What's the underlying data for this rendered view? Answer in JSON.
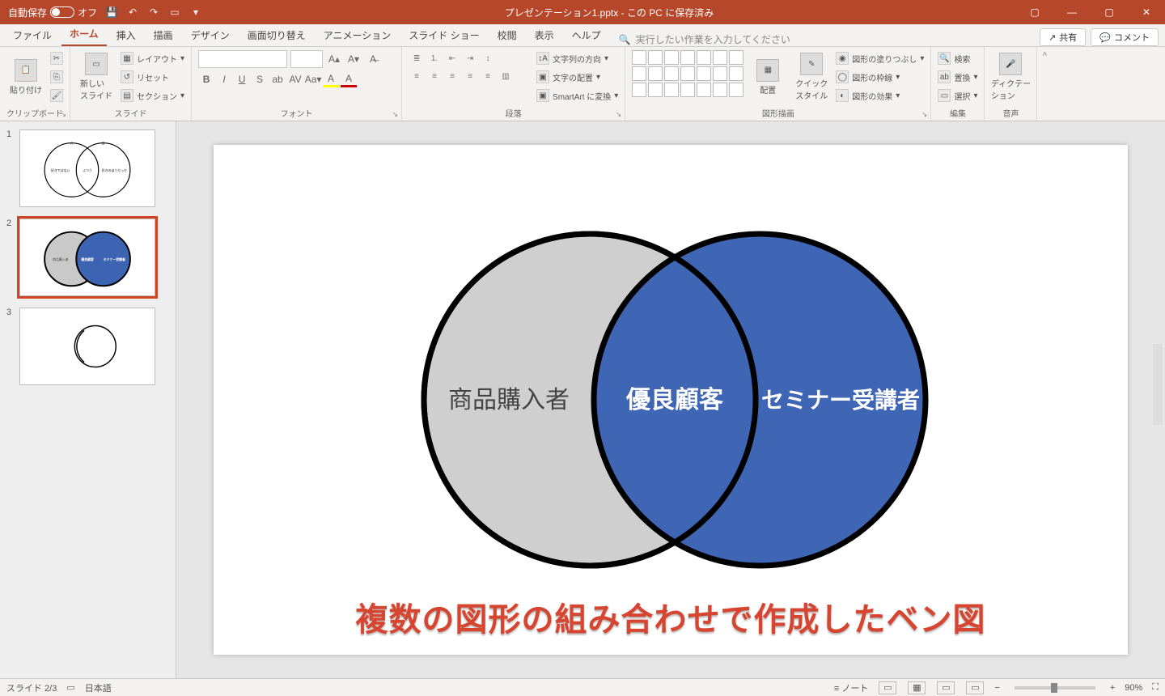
{
  "titlebar": {
    "autosave_label": "自動保存",
    "autosave_state": "オフ",
    "doc_title": "プレゼンテーション1.pptx - この PC に保存済み"
  },
  "tabs": {
    "file": "ファイル",
    "home": "ホーム",
    "insert": "挿入",
    "draw": "描画",
    "design": "デザイン",
    "transitions": "画面切り替え",
    "animations": "アニメーション",
    "slideshow": "スライド ショー",
    "review": "校閲",
    "view": "表示",
    "help": "ヘルプ",
    "tell_me": "実行したい作業を入力してください",
    "share": "共有",
    "comments": "コメント"
  },
  "ribbon": {
    "clipboard": {
      "paste": "貼り付け",
      "label": "クリップボード"
    },
    "slides": {
      "new_slide": "新しい\nスライド",
      "layout": "レイアウト",
      "reset": "リセット",
      "section": "セクション",
      "label": "スライド"
    },
    "font": {
      "label": "フォント"
    },
    "paragraph": {
      "text_dir": "文字列の方向",
      "align_text": "文字の配置",
      "smartart": "SmartArt に変換",
      "label": "段落"
    },
    "drawing": {
      "arrange": "配置",
      "quick_styles": "クイック\nスタイル",
      "fill": "図形の塗りつぶし",
      "outline": "図形の枠線",
      "effects": "図形の効果",
      "label": "図形描画"
    },
    "editing": {
      "find": "検索",
      "replace": "置換",
      "select": "選択",
      "label": "編集"
    },
    "voice": {
      "dictate": "ディクテー\nション",
      "label": "音声"
    }
  },
  "slide": {
    "venn": {
      "left_label": "商品購入者",
      "center_label": "優良顧客",
      "right_label": "セミナー受講者"
    },
    "big_title": "複数の図形の組み合わせで作成したベン図"
  },
  "thumbs": {
    "t1": {
      "left": "好きではない",
      "center": "ふつう",
      "right": "好きのほうだった",
      "a": "A",
      "b": "B"
    },
    "t2": {
      "left": "商品購入者",
      "center": "優良顧客",
      "right": "セミナー受講者"
    }
  },
  "status": {
    "slide": "スライド 2/3",
    "lang": "日本語",
    "notes": "ノート",
    "zoom": "90%"
  }
}
